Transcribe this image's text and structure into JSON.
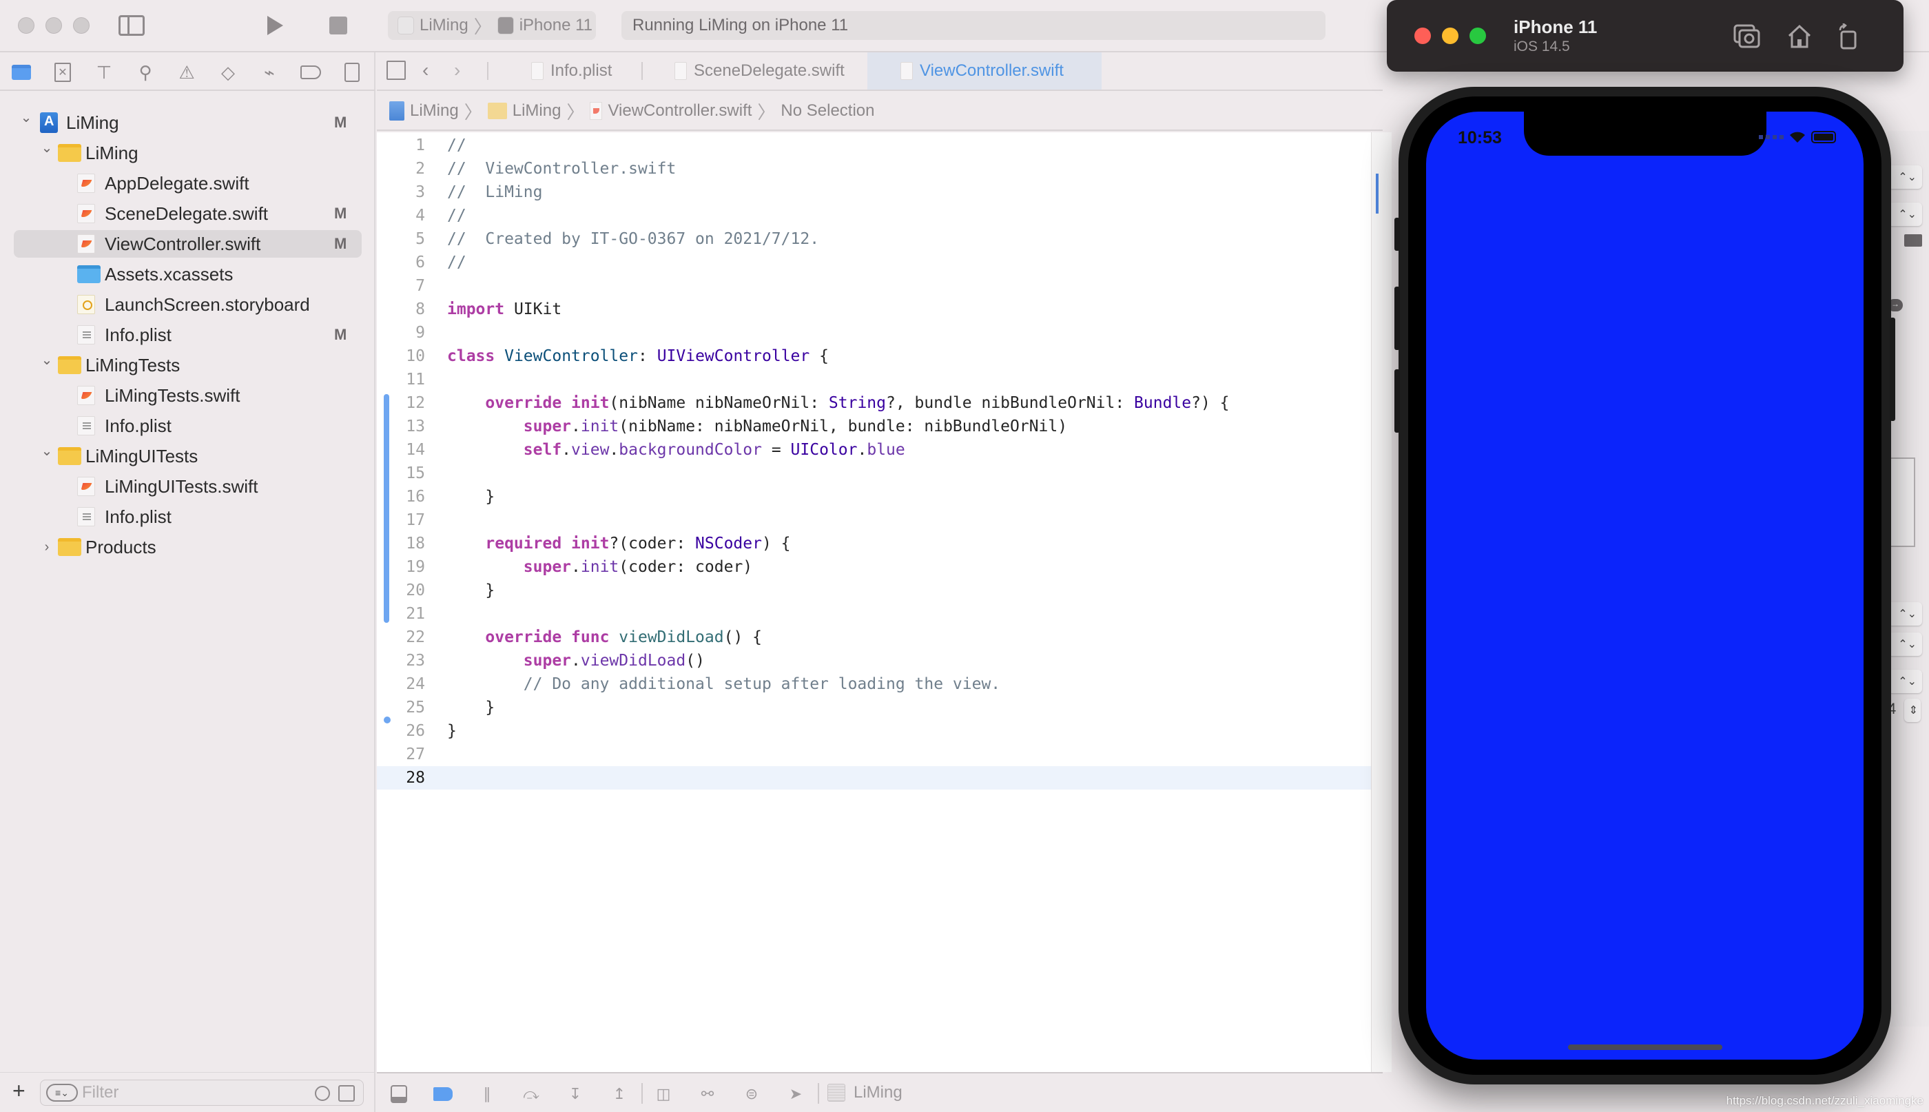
{
  "window": {
    "title_controls": [
      "close",
      "minimize",
      "zoom"
    ],
    "scheme": {
      "project": "LiMing",
      "device": "iPhone 11"
    },
    "status": "Running LiMing on iPhone 11"
  },
  "navigator": {
    "toolbar_icons": [
      "folder-icon",
      "source-control-icon",
      "hierarchy-icon",
      "search-icon",
      "warning-icon",
      "test-icon",
      "debug-icon",
      "breakpoint-icon",
      "report-icon"
    ],
    "tree": [
      {
        "label": "LiMing",
        "type": "project",
        "level": 0,
        "expanded": true,
        "badge": "M"
      },
      {
        "label": "LiMing",
        "type": "folder",
        "level": 1,
        "expanded": true,
        "badge": ""
      },
      {
        "label": "AppDelegate.swift",
        "type": "swift",
        "level": 2,
        "badge": ""
      },
      {
        "label": "SceneDelegate.swift",
        "type": "swift",
        "level": 2,
        "badge": "M"
      },
      {
        "label": "ViewController.swift",
        "type": "swift",
        "level": 2,
        "badge": "M",
        "selected": true
      },
      {
        "label": "Assets.xcassets",
        "type": "xcassets",
        "level": 2,
        "badge": ""
      },
      {
        "label": "LaunchScreen.storyboard",
        "type": "storyboard",
        "level": 2,
        "badge": ""
      },
      {
        "label": "Info.plist",
        "type": "plist",
        "level": 2,
        "badge": "M"
      },
      {
        "label": "LiMingTests",
        "type": "folder",
        "level": 1,
        "expanded": true,
        "badge": ""
      },
      {
        "label": "LiMingTests.swift",
        "type": "swift",
        "level": 2,
        "badge": ""
      },
      {
        "label": "Info.plist",
        "type": "plist",
        "level": 2,
        "badge": ""
      },
      {
        "label": "LiMingUITests",
        "type": "folder",
        "level": 1,
        "expanded": true,
        "badge": ""
      },
      {
        "label": "LiMingUITests.swift",
        "type": "swift",
        "level": 2,
        "badge": ""
      },
      {
        "label": "Info.plist",
        "type": "plist",
        "level": 2,
        "badge": ""
      },
      {
        "label": "Products",
        "type": "folder",
        "level": 1,
        "expanded": false,
        "badge": ""
      }
    ],
    "filter": {
      "placeholder": "Filter",
      "value": ""
    },
    "add_label": "+"
  },
  "editor": {
    "tabs": [
      {
        "label": "Info.plist",
        "active": false
      },
      {
        "label": "SceneDelegate.swift",
        "active": false
      },
      {
        "label": "ViewController.swift",
        "active": true
      }
    ],
    "breadcrumb": [
      "LiMing",
      "LiMing",
      "ViewController.swift",
      "No Selection"
    ],
    "current_line": 28,
    "lines": [
      [
        [
          "c",
          "//"
        ]
      ],
      [
        [
          "c",
          "//  ViewController.swift"
        ]
      ],
      [
        [
          "c",
          "//  LiMing"
        ]
      ],
      [
        [
          "c",
          "//"
        ]
      ],
      [
        [
          "c",
          "//  Created by IT-GO-0367 on 2021/7/12."
        ]
      ],
      [
        [
          "c",
          "//"
        ]
      ],
      [],
      [
        [
          "k",
          "import"
        ],
        [
          "p",
          " UIKit"
        ]
      ],
      [],
      [
        [
          "k",
          "class"
        ],
        [
          "p",
          " "
        ],
        [
          "d",
          "ViewController"
        ],
        [
          "p",
          ": "
        ],
        [
          "t",
          "UIViewController"
        ],
        [
          "p",
          " {"
        ]
      ],
      [],
      [
        [
          "p",
          "    "
        ],
        [
          "k",
          "override"
        ],
        [
          "p",
          " "
        ],
        [
          "k",
          "init"
        ],
        [
          "p",
          "(nibName nibNameOrNil: "
        ],
        [
          "t",
          "String"
        ],
        [
          "p",
          "?, bundle nibBundleOrNil: "
        ],
        [
          "t",
          "Bundle"
        ],
        [
          "p",
          "?) {"
        ]
      ],
      [
        [
          "p",
          "        "
        ],
        [
          "k",
          "super"
        ],
        [
          "p",
          "."
        ],
        [
          "r",
          "init"
        ],
        [
          "p",
          "(nibName: nibNameOrNil, bundle: nibBundleOrNil)"
        ]
      ],
      [
        [
          "p",
          "        "
        ],
        [
          "k",
          "self"
        ],
        [
          "p",
          "."
        ],
        [
          "r",
          "view"
        ],
        [
          "p",
          "."
        ],
        [
          "r",
          "backgroundColor"
        ],
        [
          "p",
          " = "
        ],
        [
          "t",
          "UIColor"
        ],
        [
          "p",
          "."
        ],
        [
          "r",
          "blue"
        ]
      ],
      [],
      [
        [
          "p",
          "    }"
        ]
      ],
      [],
      [
        [
          "p",
          "    "
        ],
        [
          "k",
          "required"
        ],
        [
          "p",
          " "
        ],
        [
          "k",
          "init"
        ],
        [
          "p",
          "?(coder: "
        ],
        [
          "t",
          "NSCoder"
        ],
        [
          "p",
          ") {"
        ]
      ],
      [
        [
          "p",
          "        "
        ],
        [
          "k",
          "super"
        ],
        [
          "p",
          "."
        ],
        [
          "r",
          "init"
        ],
        [
          "p",
          "(coder: coder)"
        ]
      ],
      [
        [
          "p",
          "    }"
        ]
      ],
      [],
      [
        [
          "p",
          "    "
        ],
        [
          "k",
          "override"
        ],
        [
          "p",
          " "
        ],
        [
          "k",
          "func"
        ],
        [
          "p",
          " "
        ],
        [
          "f",
          "viewDidLoad"
        ],
        [
          "p",
          "() {"
        ]
      ],
      [
        [
          "p",
          "        "
        ],
        [
          "k",
          "super"
        ],
        [
          "p",
          "."
        ],
        [
          "r",
          "viewDidLoad"
        ],
        [
          "p",
          "()"
        ]
      ],
      [
        [
          "p",
          "        "
        ],
        [
          "c",
          "// Do any additional setup after loading the view."
        ]
      ],
      [
        [
          "p",
          "    }"
        ]
      ],
      [
        [
          "p",
          "}"
        ]
      ],
      [],
      []
    ],
    "changed_lines_range": [
      12,
      21
    ],
    "change_marker_line": 26
  },
  "debug_bar": {
    "icons": [
      "hide-debug-area-icon",
      "breakpoints-toggle-icon",
      "pause-icon",
      "step-over-icon",
      "step-into-icon",
      "step-out-icon",
      "view-hierarchy-icon",
      "memory-graph-icon",
      "environment-overrides-icon",
      "simulate-location-icon"
    ],
    "target_label": "LiMing"
  },
  "simulator": {
    "device_name": "iPhone 11",
    "os_version": "iOS 14.5",
    "buttons": [
      "screenshot-button",
      "home-button",
      "rotate-button"
    ],
    "status_time": "10:53",
    "screen_color": "#0b24fb"
  },
  "inspector": {
    "visible_value": "4"
  },
  "watermark": "https://blog.csdn.net/zzuli_xiaomingke"
}
